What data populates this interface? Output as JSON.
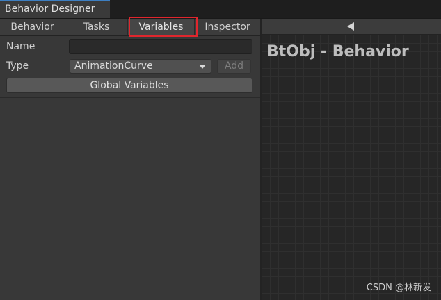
{
  "window": {
    "tab_title": "Behavior Designer"
  },
  "toolbar": {
    "tabs": [
      {
        "label": "Behavior"
      },
      {
        "label": "Tasks"
      },
      {
        "label": "Variables"
      },
      {
        "label": "Inspector"
      }
    ]
  },
  "variables_form": {
    "name_label": "Name",
    "name_value": "",
    "type_label": "Type",
    "type_value": "AnimationCurve",
    "add_label": "Add",
    "global_label": "Global Variables"
  },
  "graph": {
    "title": "BtObj - Behavior",
    "watermark": "CSDN @林新发"
  },
  "colors": {
    "highlight": "#e0262d",
    "window_tab_accent": "#3d7fc2"
  },
  "icons": {
    "collapse": "triangle-left-icon",
    "dropdown": "chevron-down-icon"
  }
}
